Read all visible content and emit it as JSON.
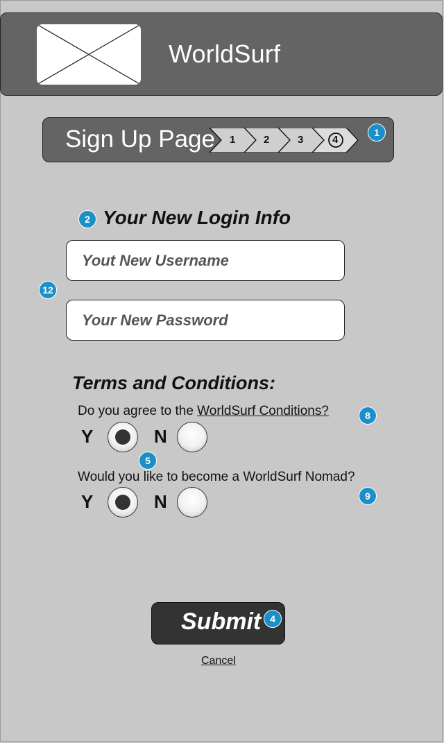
{
  "header": {
    "app_title": "WorldSurf",
    "logo_icon": "image-placeholder-icon"
  },
  "stepbar": {
    "title": "Sign Up Page",
    "steps": [
      "1",
      "2",
      "3",
      "4"
    ],
    "current_step": "4"
  },
  "annotations": {
    "a1": "1",
    "a2": "2",
    "a12": "12",
    "a8": "8",
    "a5": "5",
    "a9": "9",
    "a4": "4"
  },
  "login": {
    "heading": "Your New Login Info",
    "username_placeholder": "Yout New Username",
    "password_placeholder": "Your New Password"
  },
  "terms": {
    "heading": "Terms and Conditions:",
    "q1_prefix": "Do you agree to the ",
    "q1_link": "WorldSurf Conditions?",
    "q1_selected": "Y",
    "q2_text": "Would you like to become a WorldSurf Nomad?",
    "q2_selected": "Y",
    "yes_label": "Y",
    "no_label": "N"
  },
  "actions": {
    "submit_label": "Submit",
    "cancel_label": "Cancel"
  },
  "colors": {
    "background": "#c8c8c8",
    "header": "#646464",
    "badge": "#1a8fc8",
    "submit": "#333333"
  }
}
